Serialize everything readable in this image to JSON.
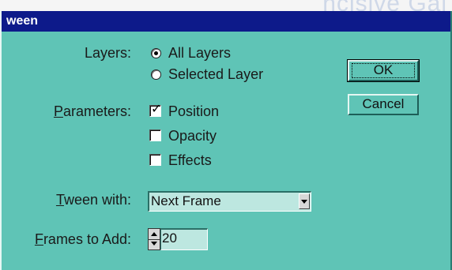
{
  "background": {
    "watermark_text": "ncisive Gal"
  },
  "dialog": {
    "title": "ween",
    "colors": {
      "title_bar": "#0d1a8a",
      "body": "#5fc4b6"
    }
  },
  "layers": {
    "label": "Layers:",
    "options": [
      {
        "label": "All Layers",
        "checked": true
      },
      {
        "label": "Selected Layer",
        "checked": false
      }
    ]
  },
  "parameters": {
    "label_underlined": "P",
    "label_rest": "arameters:",
    "options": [
      {
        "label": "Position",
        "checked": true
      },
      {
        "label": "Opacity",
        "checked": false
      },
      {
        "label": "Effects",
        "checked": false
      }
    ]
  },
  "tween_with": {
    "label_underlined": "T",
    "label_rest": "ween with:",
    "selected": "Next Frame"
  },
  "frames_to_add": {
    "label_underlined": "F",
    "label_rest": "rames to Add:",
    "value": "20"
  },
  "buttons": {
    "ok": "OK",
    "cancel": "Cancel"
  }
}
